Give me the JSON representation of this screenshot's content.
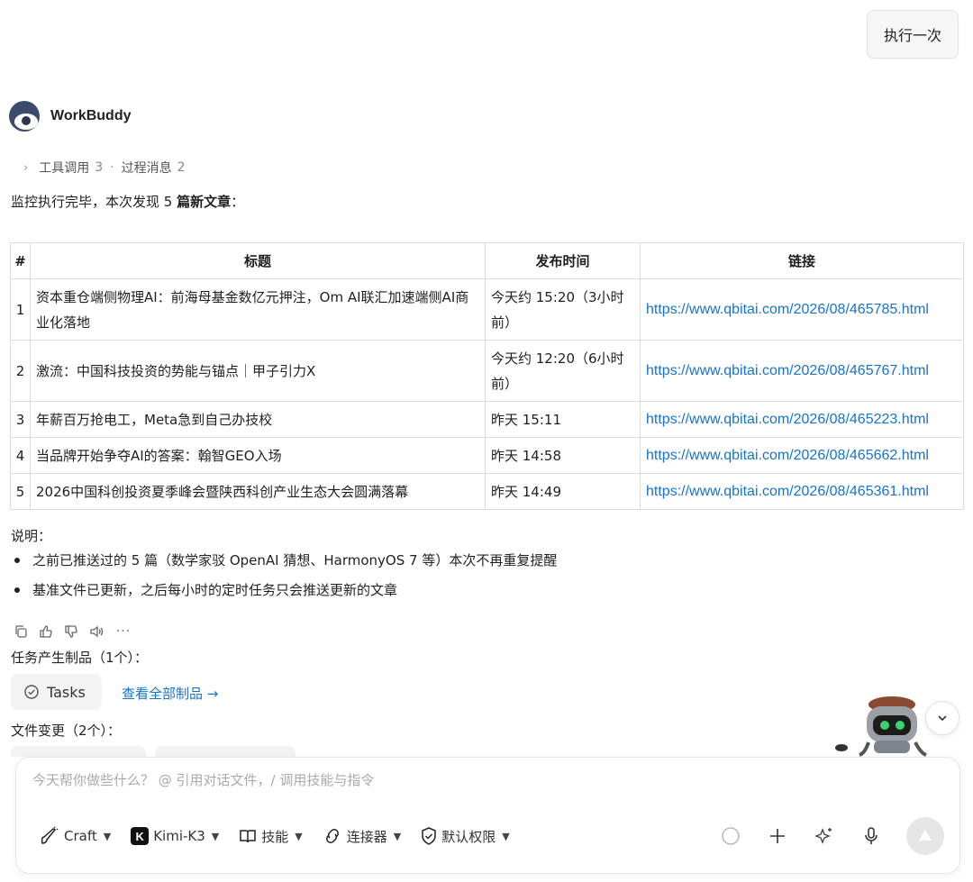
{
  "header": {
    "run_once_label": "执行一次"
  },
  "assistant": {
    "name": "WorkBuddy"
  },
  "process": {
    "tool_calls_label": "工具调用",
    "tool_calls_count": "3",
    "separator": "·",
    "process_msgs_label": "过程消息",
    "process_msgs_count": "2"
  },
  "summary": {
    "prefix": "监控执行完毕，本次发现 5 ",
    "bold": "篇新文章",
    "suffix": "："
  },
  "table": {
    "headers": {
      "num": "#",
      "title": "标题",
      "time": "发布时间",
      "link": "链接"
    },
    "rows": [
      {
        "num": "1",
        "title": "资本重仓端侧物理AI：前海母基金数亿元押注，Om AI联汇加速端侧AI商业化落地",
        "time": "今天约 15:20（3小时前）",
        "link": "https://www.qbitai.com/2026/08/465785.html"
      },
      {
        "num": "2",
        "title": "激流：中国科技投资的势能与锚点｜甲子引力X",
        "time": "今天约 12:20（6小时前）",
        "link": "https://www.qbitai.com/2026/08/465767.html"
      },
      {
        "num": "3",
        "title": "年薪百万抢电工，Meta急到自己办技校",
        "time": "昨天 15:11",
        "link": "https://www.qbitai.com/2026/08/465223.html"
      },
      {
        "num": "4",
        "title": "当品牌开始争夺AI的答案：翰智GEO入场",
        "time": "昨天 14:58",
        "link": "https://www.qbitai.com/2026/08/465662.html"
      },
      {
        "num": "5",
        "title": "2026中国科创投资夏季峰会暨陕西科创产业生态大会圆满落幕",
        "time": "昨天 14:49",
        "link": "https://www.qbitai.com/2026/08/465361.html"
      }
    ]
  },
  "notes": {
    "title": "说明：",
    "items": [
      "之前已推送过的 5 篇（数学家驳 OpenAI 猜想、HarmonyOS 7 等）本次不再重复提醒",
      "基准文件已更新，之后每小时的定时任务只会推送更新的文章"
    ]
  },
  "message_actions": [
    "copy-icon",
    "thumbs-up-icon",
    "thumbs-down-icon",
    "speaker-icon",
    "more-icon"
  ],
  "artifacts": {
    "title": "任务产生制品（1个）：",
    "chip_label": "Tasks",
    "view_all": "查看全部制品 →"
  },
  "files": {
    "title": "文件变更（2个）："
  },
  "composer": {
    "placeholder": "今天帮你做些什么？ @ 引用对话文件，/ 调用技能与指令",
    "mode_label": "Craft",
    "model_badge": "K",
    "model_label": "Kimi-K3",
    "skills_label": "技能",
    "connectors_label": "连接器",
    "permissions_label": "默认权限"
  },
  "colors": {
    "link": "#1a73c8",
    "border": "#dcdcdc",
    "chip_bg": "#f3f3f3"
  }
}
